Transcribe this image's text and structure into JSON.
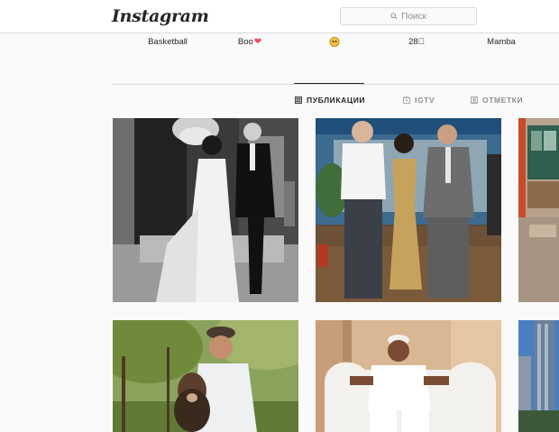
{
  "header": {
    "logo": "Instagram",
    "search_placeholder": "Поиск"
  },
  "highlights": [
    {
      "label": "Basketball",
      "icon": null
    },
    {
      "label": "Boo",
      "icon": "red-heart-icon"
    },
    {
      "label": "",
      "icon": "emoji-face-icon"
    },
    {
      "label": "28⃣",
      "icon": null
    },
    {
      "label": "Mamba",
      "icon": null
    }
  ],
  "tabs": [
    {
      "label": "ПУБЛИКАЦИИ",
      "icon": "grid-icon",
      "active": true
    },
    {
      "label": "IGTV",
      "icon": "igtv-icon",
      "active": false
    },
    {
      "label": "ОТМЕТКИ",
      "icon": "tagged-icon",
      "active": false
    }
  ],
  "posts": [
    {
      "name": "post-wedding-photo"
    },
    {
      "name": "post-three-people-photo"
    },
    {
      "name": "post-room-photo"
    },
    {
      "name": "post-man-with-dog-photo"
    },
    {
      "name": "post-man-in-white-chair-photo"
    },
    {
      "name": "post-city-towers-photo"
    }
  ],
  "colors": {
    "border": "#dbdbdb",
    "background": "#fafafa",
    "text": "#262626",
    "muted": "#8e8e8e",
    "heart": "#ed4956"
  }
}
